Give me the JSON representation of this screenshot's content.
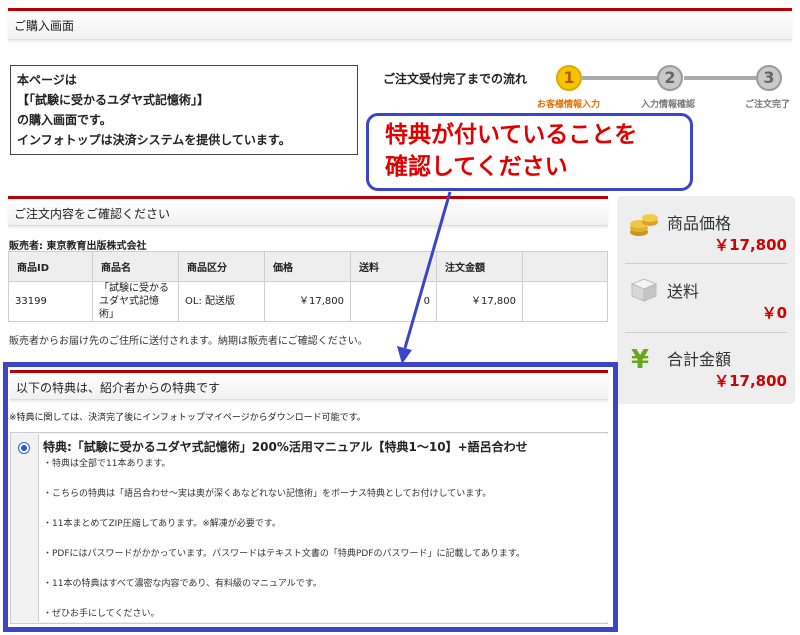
{
  "header": {
    "title": "ご購入画面"
  },
  "intro": {
    "lines": [
      "本ページは",
      "【「試験に受かるユダヤ式記憶術」】",
      "の購入画面です。",
      "インフォトップは決済システムを提供しています。"
    ]
  },
  "flow": {
    "title": "ご注文受付完了までの流れ",
    "steps": [
      {
        "number": "1",
        "label": "お客様情報入力",
        "state": "active"
      },
      {
        "number": "2",
        "label": "入力情報確認",
        "state": "inactive"
      },
      {
        "number": "3",
        "label": "ご注文完了",
        "state": "inactive"
      }
    ]
  },
  "callout": {
    "line1": "特典が付いていることを",
    "line2": "確認してください"
  },
  "order": {
    "heading": "ご注文内容をご確認ください",
    "seller": "販売者: 東京教育出版株式会社",
    "columns": [
      "商品ID",
      "商品名",
      "商品区分",
      "価格",
      "送料",
      "注文金額",
      ""
    ],
    "rows": [
      {
        "id": "33199",
        "name": "「試験に受かるユダヤ式記憶術」",
        "category": "OL: 配送版",
        "price": "￥17,800",
        "shipping": "0",
        "total": "￥17,800"
      }
    ],
    "note": "販売者からお届け先のご住所に送付されます。納期は販売者にご確認ください。"
  },
  "summary": {
    "product_label": "商品価格",
    "product_value": "￥17,800",
    "shipping_label": "送料",
    "shipping_value": "￥0",
    "total_label": "合計金額",
    "total_value": "￥17,800",
    "icons": [
      "coins-icon",
      "box-icon",
      "yen-icon"
    ]
  },
  "bonus": {
    "heading": "以下の特典は、紹介者からの特典です",
    "note": "※特典に関しては、決済完了後にインフォトップマイページからダウンロード可能です。",
    "title": "特典:「試験に受かるユダヤ式記憶術」200%活用マニュアル【特典1〜10】+語呂合わせ",
    "lines": [
      "・特典は全部で11本あります。",
      "・こちらの特典は「語呂合わせ〜実は奥が深くあなどれない記憶術」をボーナス特典としてお付けしています。",
      "・11本まとめてZIP圧縮してあります。※解凍が必要です。",
      "・PDFにはパスワードがかかっています。パスワードはテキスト文書の「特典PDFのパスワード」に記載してあります。",
      "・11本の特典はすべて濃密な内容であり、有料級のマニュアルです。",
      "・ぜひお手にしてください。"
    ]
  },
  "colors": {
    "accent_red": "#b80000",
    "price_red": "#d10000",
    "callout_blue": "#3b45c7",
    "step_active": "#f5c400",
    "step_inactive": "#9a9a9a"
  }
}
